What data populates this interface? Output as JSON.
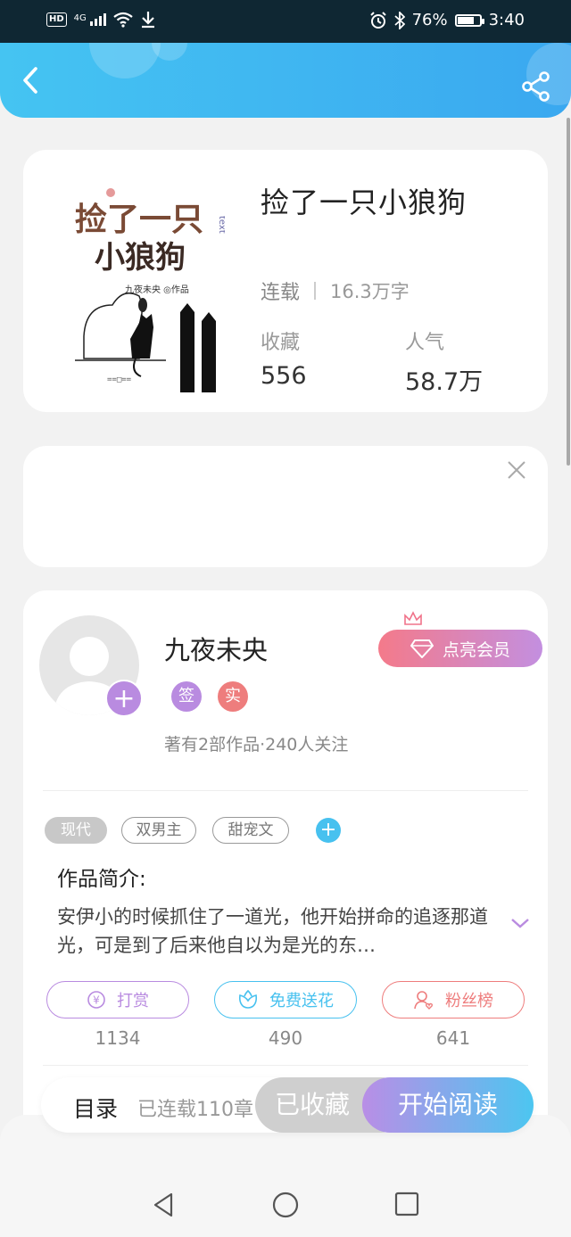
{
  "status_bar": {
    "hd": "HD",
    "network": "4G",
    "battery_text": "76%",
    "battery_level": 0.76,
    "time": "3:40"
  },
  "header": {
    "back_icon": "chevron-left-icon",
    "share_icon": "share-icon",
    "gradient": [
      "#45c4f2",
      "#3aa8f0"
    ]
  },
  "book": {
    "title": "捡了一只小狼狗",
    "status": "连载",
    "word_count": "16.3万字",
    "favorites_label": "收藏",
    "favorites_value": "556",
    "popularity_label": "人气",
    "popularity_value": "58.7万",
    "cover": {
      "title_line1": "捡了一只",
      "title_line2": "小狼狗",
      "author_credit": "九夜未央 ◎作品",
      "side_text": "text"
    }
  },
  "ad": {
    "close_icon": "close-icon"
  },
  "author": {
    "name": "九夜未央",
    "badge_sign": "签",
    "badge_real": "实",
    "meta": "著有2部作品·240人关注",
    "vip_button": "点亮会员",
    "follow_icon": "plus-icon"
  },
  "tags": [
    "现代",
    "双男主",
    "甜宠文"
  ],
  "intro": {
    "title": "作品简介:",
    "text": "安伊小的时候抓住了一道光，他开始拼命的追逐那道光，可是到了后来他自以为是光的东…"
  },
  "actions": [
    {
      "label": "打赏",
      "count": "1134",
      "icon": "yuan-icon",
      "color": "#b98be0"
    },
    {
      "label": "免费送花",
      "count": "490",
      "icon": "flower-icon",
      "color": "#47c1ef"
    },
    {
      "label": "粉丝榜",
      "count": "641",
      "icon": "fans-icon",
      "color": "#ee7d7d"
    }
  ],
  "bottom_bar": {
    "toc_label": "目录",
    "toc_count": "已连载110章",
    "favorited_button": "已收藏",
    "read_button": "开始阅读"
  },
  "nav": [
    "back-triangle-icon",
    "home-circle-icon",
    "recents-square-icon"
  ]
}
